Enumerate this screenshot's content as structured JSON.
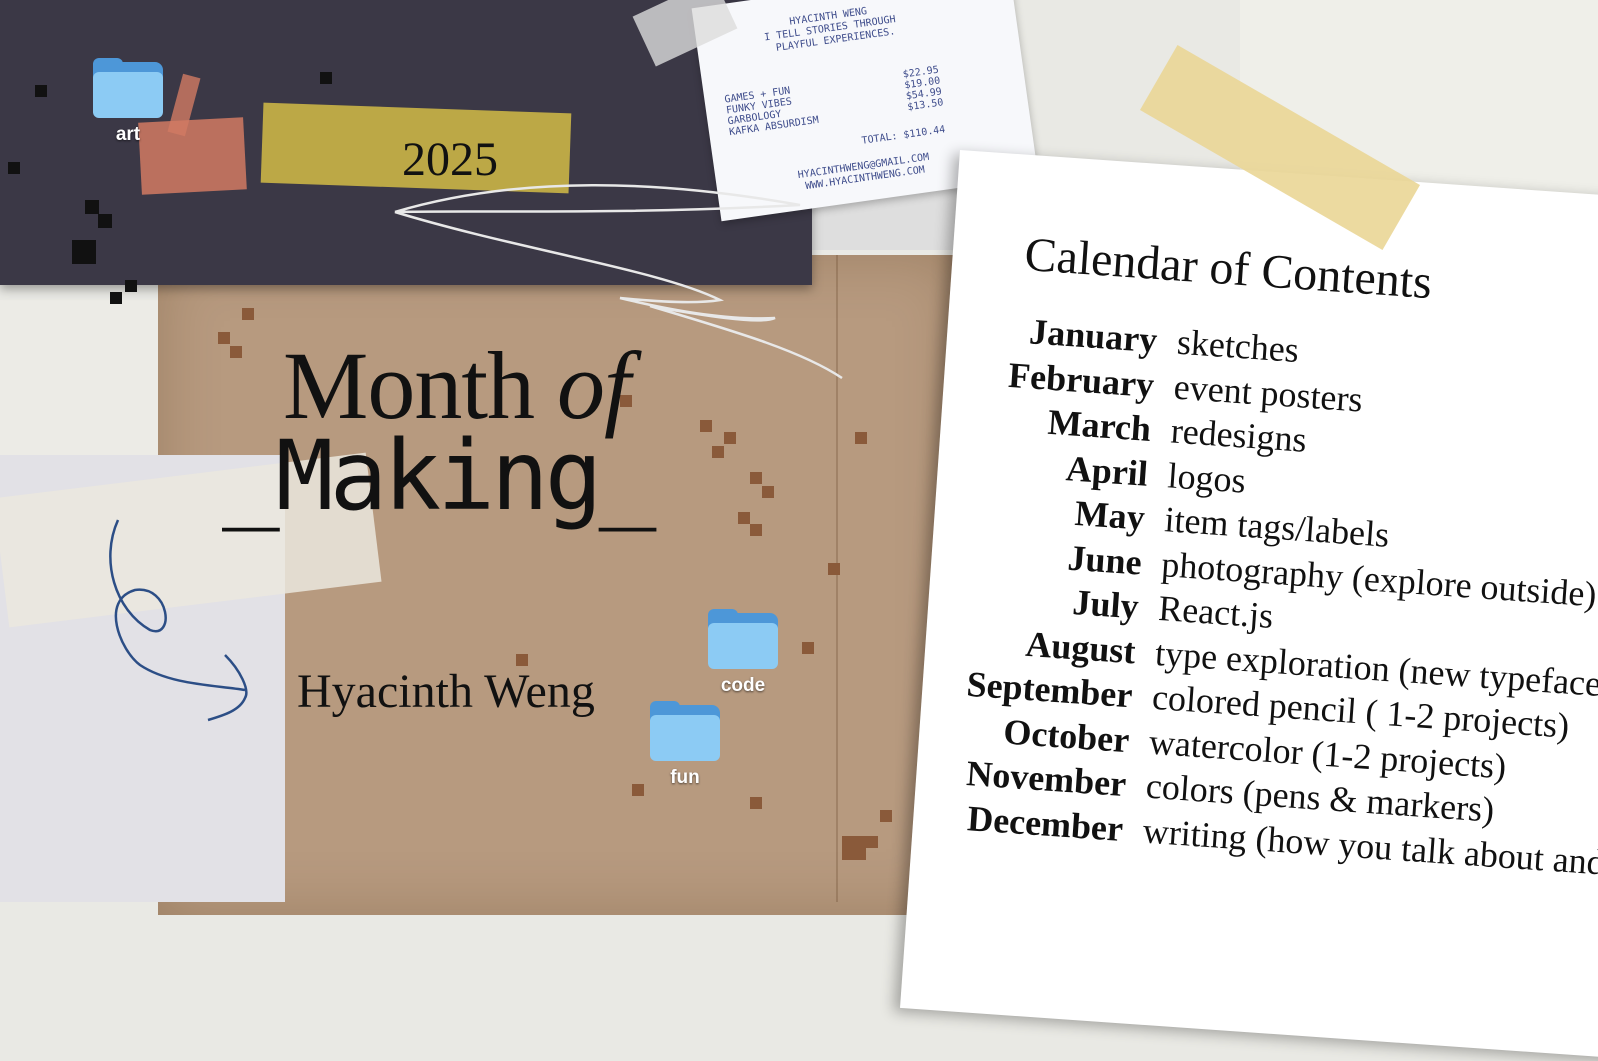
{
  "year": "2025",
  "title": {
    "line1_main": "Month ",
    "line1_italic": "of",
    "line2": "_Making_"
  },
  "author": "Hyacinth Weng",
  "folders": [
    {
      "label": "art"
    },
    {
      "label": "code"
    },
    {
      "label": "fun"
    }
  ],
  "receipt": {
    "header": [
      "HYACINTH WENG",
      "I TELL STORIES THROUGH",
      "PLAYFUL EXPERIENCES."
    ],
    "items": [
      {
        "name": "GAMES + FUN",
        "price": "$22.95"
      },
      {
        "name": "FUNKY VIBES",
        "price": "$19.00"
      },
      {
        "name": "GARBOLOGY",
        "price": "$54.99"
      },
      {
        "name": "KAFKA ABSURDISM",
        "price": "$13.50"
      }
    ],
    "total": "TOTAL: $110.44",
    "email": "HYACINTHWENG@GMAIL.COM",
    "website": "WWW.HYACINTHWENG.COM"
  },
  "calendar": {
    "title": "Calendar of Contents",
    "entries": [
      {
        "month": "January",
        "topic": "sketches"
      },
      {
        "month": "February",
        "topic": "event posters"
      },
      {
        "month": "March",
        "topic": "redesigns"
      },
      {
        "month": "April",
        "topic": "logos"
      },
      {
        "month": "May",
        "topic": "item tags/labels"
      },
      {
        "month": "June",
        "topic": "photography (explore outside)"
      },
      {
        "month": "July",
        "topic": "React.js"
      },
      {
        "month": "August",
        "topic": "type exploration (new typeface d"
      },
      {
        "month": "September",
        "topic": "colored pencil ( 1-2 projects)"
      },
      {
        "month": "October",
        "topic": "watercolor (1-2 projects)"
      },
      {
        "month": "November",
        "topic": "colors (pens & markers)"
      },
      {
        "month": "December",
        "topic": "writing (how you talk about and"
      }
    ]
  },
  "colors": {
    "dark_paper": "#3b3846",
    "kraft_paper": "#b79a7f",
    "folder_blue": "#8ccbf4",
    "tape_gold": "#c8b246",
    "receipt_ink": "#3f4d8c"
  }
}
